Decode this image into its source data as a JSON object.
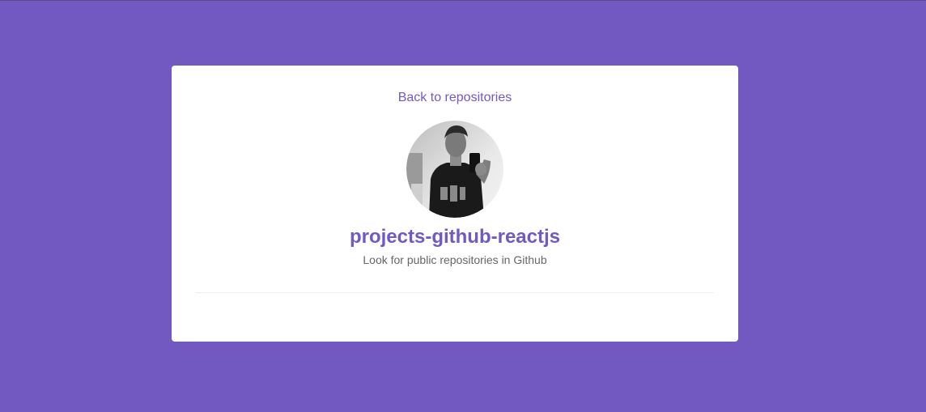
{
  "page": {
    "background_color": "#7159c1"
  },
  "owner": {
    "back_label": "Back to repositories",
    "repo_name": "projects-github-reactjs",
    "description": "Look for public repositories in Github",
    "avatar_alt": "avatar"
  },
  "colors": {
    "accent": "#7159c1",
    "description_text": "#666666",
    "card_bg": "#ffffff",
    "divider": "#eeeeee"
  }
}
